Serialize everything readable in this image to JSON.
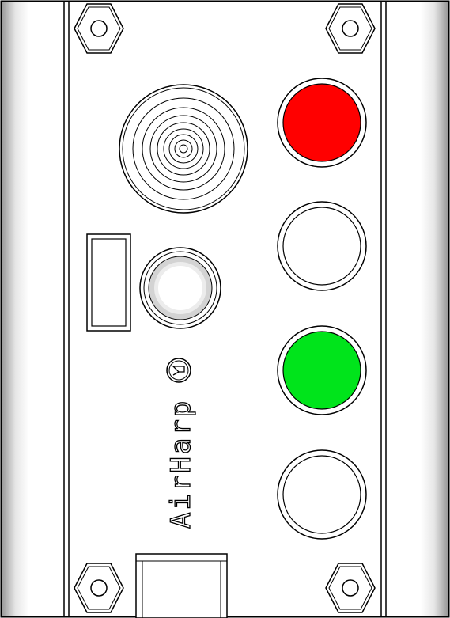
{
  "title": "",
  "brand": {
    "name": "AirHarp",
    "trademark_symbol": "®"
  },
  "colors": {
    "outline": "#000000",
    "housing_fill": "#ffffff",
    "housing_shade": "#b9b9b9",
    "button_stop": "#ff0000",
    "button_start": "#00e41b",
    "button_white": "#ffffff",
    "indicator_ring": "#d3d3d3"
  },
  "buttons": [
    {
      "id": "red-pushbutton",
      "color": "#ff0000"
    },
    {
      "id": "white-pushbutton-1",
      "color": "#ffffff"
    },
    {
      "id": "green-pushbutton",
      "color": "#00e41b"
    },
    {
      "id": "white-pushbutton-2",
      "color": "#ffffff"
    }
  ],
  "icons": {
    "buzzer": "concentric-rings-icon",
    "indicator": "pilot-light-icon",
    "screw": "hex-screw-icon",
    "label_slot": "label-window-icon",
    "connector": "cable-gland-icon"
  }
}
